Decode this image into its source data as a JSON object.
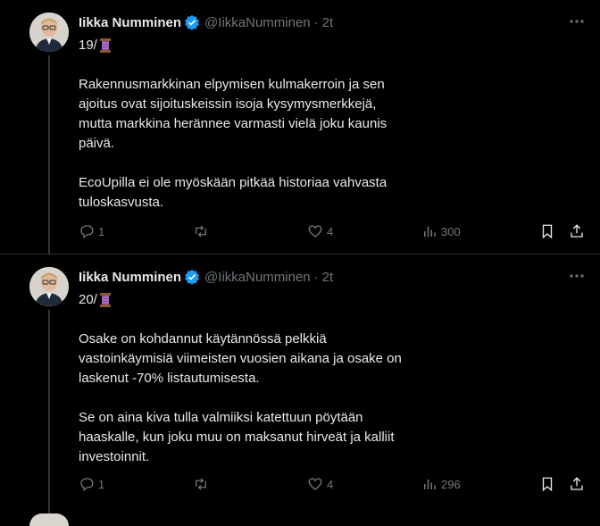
{
  "tweets": [
    {
      "name": "Iikka Numminen",
      "handle": "@IikkaNumminen",
      "dot": "·",
      "time": "2t",
      "number": "19/",
      "paragraphs": [
        "Rakennusmarkkinan elpymisen kulmakerroin ja sen ajoitus ovat sijoituskeissin isoja kysymysmerkkejä, mutta markkina herännee varmasti vielä joku kaunis päivä.",
        "EcoUpilla ei ole myöskään pitkää historiaa vahvasta tuloskasvusta."
      ],
      "replies": "1",
      "retweets": "",
      "likes": "4",
      "views": "300"
    },
    {
      "name": "Iikka Numminen",
      "handle": "@IikkaNumminen",
      "dot": "·",
      "time": "2t",
      "number": "20/",
      "paragraphs": [
        "Osake on kohdannut käytännössä pelkkiä vastoinkäymisiä viimeisten vuosien aikana ja osake on laskenut -70% listautumisesta.",
        "Se on aina kiva tulla valmiiksi katettuun pöytään haaskalle, kun joku muu on maksanut hirveät ja kalliit investoinnit."
      ],
      "replies": "1",
      "retweets": "",
      "likes": "4",
      "views": "296"
    }
  ],
  "icons": {
    "verified": "verified-badge-icon",
    "spool": "thread-spool-emoji",
    "more": "more-icon",
    "reply": "reply-icon",
    "retweet": "retweet-icon",
    "like": "heart-icon",
    "views": "views-icon",
    "bookmark": "bookmark-icon",
    "share": "share-icon"
  },
  "colors": {
    "background": "#000000",
    "text": "#e7e9ea",
    "muted": "#71767b",
    "verified": "#1d9bf0"
  }
}
